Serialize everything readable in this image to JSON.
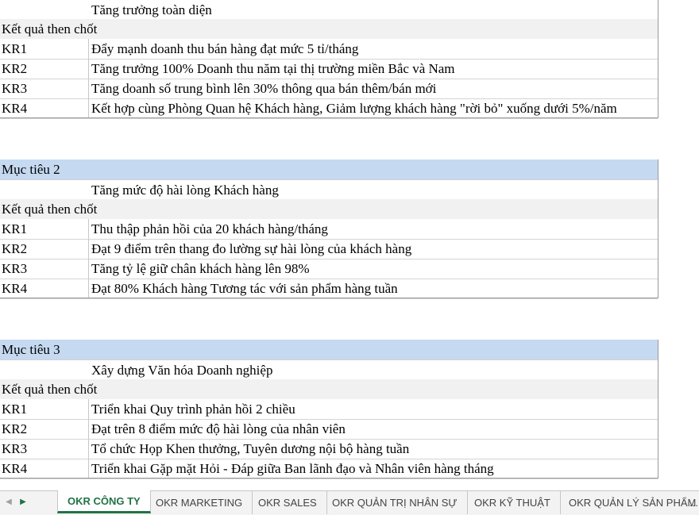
{
  "objectives": [
    {
      "goal_label": "",
      "goal_text": "Tăng trưởng toàn diện",
      "kr_heading": "Kết quả then chốt",
      "krs": [
        {
          "id": "KR1",
          "text": "Đẩy mạnh doanh thu bán hàng đạt mức 5 tỉ/tháng"
        },
        {
          "id": "KR2",
          "text": "Tăng trưởng 100% Doanh thu năm tại thị trường miền Bắc và Nam"
        },
        {
          "id": "KR3",
          "text": "Tăng doanh số trung bình lên 30% thông qua bán thêm/bán mới"
        },
        {
          "id": "KR4",
          "text": "Kết hợp cùng Phòng Quan hệ Khách hàng, Giảm lượng khách hàng \"rời bỏ\" xuống dưới 5%/năm"
        }
      ]
    },
    {
      "goal_label": "Mục tiêu 2",
      "goal_text": "Tăng mức độ hài lòng Khách hàng",
      "kr_heading": "Kết quả then chốt",
      "krs": [
        {
          "id": "KR1",
          "text": "Thu thập phản hồi của 20 khách hàng/tháng"
        },
        {
          "id": "KR2",
          "text": "Đạt 9 điểm trên thang đo lường sự hài lòng của khách hàng"
        },
        {
          "id": "KR3",
          "text": "Tăng tỷ lệ giữ chân khách hàng lên 98%"
        },
        {
          "id": "KR4",
          "text": "Đạt 80% Khách hàng Tương tác với sản phẩm hàng tuần"
        }
      ]
    },
    {
      "goal_label": "Mục tiêu 3",
      "goal_text": "Xây dựng Văn hóa Doanh nghiệp",
      "kr_heading": "Kết quả then chốt",
      "krs": [
        {
          "id": "KR1",
          "text": "Triển khai Quy trình phản hồi 2 chiều"
        },
        {
          "id": "KR2",
          "text": "Đạt trên 8 điểm mức độ hài lòng của nhân viên"
        },
        {
          "id": "KR3",
          "text": "Tổ chức Họp Khen thưởng, Tuyên dương nội bộ hàng tuần"
        },
        {
          "id": "KR4",
          "text": "Triển khai Gặp mặt Hỏi - Đáp giữa Ban lãnh đạo và Nhân viên hàng tháng"
        }
      ]
    }
  ],
  "tabs": [
    {
      "label": "OKR CÔNG TY",
      "active": true
    },
    {
      "label": "OKR MARKETING",
      "active": false
    },
    {
      "label": "OKR SALES",
      "active": false
    },
    {
      "label": "OKR QUẢN TRỊ NHÂN SỰ",
      "active": false
    },
    {
      "label": "OKR KỸ THUẬT",
      "active": false
    },
    {
      "label": "OKR QUẢN LÝ SẢN PHẨM",
      "active": false
    }
  ],
  "tab_overflow": "...",
  "icons": {
    "prev": "triangle-left-icon",
    "next": "triangle-right-icon"
  },
  "colors": {
    "goal_fill": "#c5d9f1",
    "heading_fill": "#f1f1f1",
    "active_tab": "#217346"
  }
}
